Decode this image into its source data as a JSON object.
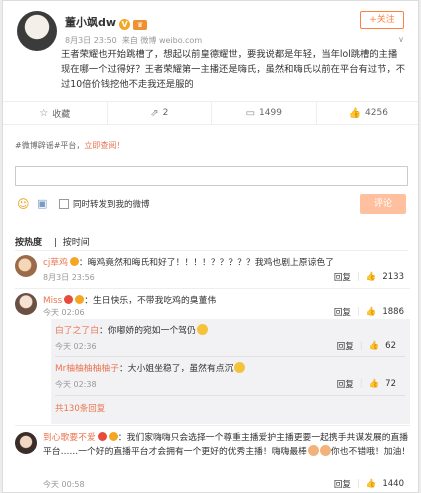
{
  "post": {
    "author": "董小飒dw",
    "time": "8月3日 23:50",
    "source": "来自 微博 weibo.com",
    "follow_label": "+关注",
    "text": "王者荣耀也开始跳槽了，想起以前皇德耀世，要我说都是年轻，当年lol跳槽的主播现在哪一个过得好？王者荣耀第一主播还是嗨氏，虽然和嗨氏以前在平台有过节，不过10倍价钱挖他不走我还是服的"
  },
  "actions": [
    {
      "icon": "star-icon",
      "label": "收藏"
    },
    {
      "icon": "share-icon",
      "label": "2"
    },
    {
      "icon": "comment-icon",
      "label": "1499"
    },
    {
      "icon": "like-icon",
      "label": "4256"
    }
  ],
  "comment_box": {
    "tag_prefix": "#微博辟谣#平台，",
    "tag_link": "立即查阅！",
    "placeholder": "",
    "repost_label": "同时转发到我的微博",
    "submit_label": "评论"
  },
  "sort": {
    "hot": "按热度",
    "time": "按时间"
  },
  "comments": [
    {
      "name": "cj草鸡",
      "text": "：晦鸡竟然和晦氏和好了！！！！？？？？？我鸡也剧上原谅色了",
      "time": "8月3日 23:56",
      "reply": "回复",
      "likes": "2133"
    },
    {
      "name": "Miss",
      "text": "：生日快乐，不带我吃鸡的臭董伟",
      "time": "今天 02:06",
      "reply": "回复",
      "likes": "1886",
      "replies": [
        {
          "name": "白了之了白",
          "text": "：你嘟娇的宛如一个驾仍",
          "time": "今天 02:36",
          "reply": "回复",
          "likes": "62"
        },
        {
          "name": "Mr柚柚柚柚柚子",
          "text": "：大小姐坐稳了，虽然有点沉",
          "time": "今天 02:38",
          "reply": "回复",
          "likes": "72"
        }
      ],
      "more": "共130条回复"
    },
    {
      "name": "到心歌要不爱",
      "text": "：我们家嗨嗨只会选择一个尊重主播爱护主播更要一起携手共谋发展的直播平台……一个好的直播平台才会拥有一个更好的优秀主播！嗨嗨最棒",
      "text2": "你也不错哦！加油！",
      "time": "今天 00:58",
      "reply": "回复",
      "likes": "1440"
    }
  ]
}
